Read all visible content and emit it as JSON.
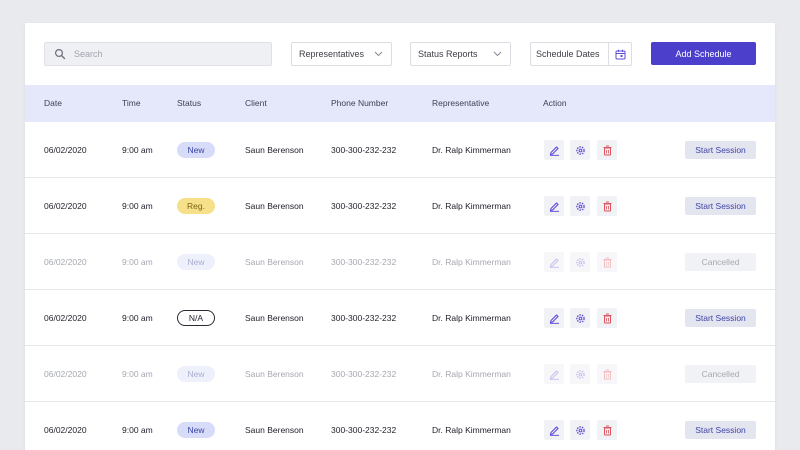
{
  "toolbar": {
    "search_placeholder": "Search",
    "representatives_label": "Representatives",
    "status_reports_label": "Status Reports",
    "schedule_dates_label": "Schedule Dates",
    "add_schedule_label": "Add Schedule"
  },
  "table": {
    "headers": {
      "date": "Date",
      "time": "Time",
      "status": "Status",
      "client": "Client",
      "phone": "Phone Number",
      "representative": "Representative",
      "action": "Action"
    },
    "rows": [
      {
        "date": "06/02/2020",
        "time": "9:00 am",
        "status": "New",
        "client": "Saun Berenson",
        "phone": "300-300-232-232",
        "representative": "Dr. Ralp Kimmerman",
        "session": "Start Session"
      },
      {
        "date": "06/02/2020",
        "time": "9:00 am",
        "status": "Reg.",
        "client": "Saun Berenson",
        "phone": "300-300-232-232",
        "representative": "Dr. Ralp Kimmerman",
        "session": "Start Session"
      },
      {
        "date": "06/02/2020",
        "time": "9:00 am",
        "status": "New",
        "client": "Saun Berenson",
        "phone": "300-300-232-232",
        "representative": "Dr. Ralp Kimmerman",
        "session": "Cancelled"
      },
      {
        "date": "06/02/2020",
        "time": "9:00 am",
        "status": "N/A",
        "client": "Saun Berenson",
        "phone": "300-300-232-232",
        "representative": "Dr. Ralp Kimmerman",
        "session": "Start Session"
      },
      {
        "date": "06/02/2020",
        "time": "9:00 am",
        "status": "New",
        "client": "Saun Berenson",
        "phone": "300-300-232-232",
        "representative": "Dr. Ralp Kimmerman",
        "session": "Cancelled"
      },
      {
        "date": "06/02/2020",
        "time": "9:00 am",
        "status": "New",
        "client": "Saun Berenson",
        "phone": "300-300-232-232",
        "representative": "Dr. Ralp Kimmerman",
        "session": "Start Session"
      }
    ]
  },
  "icons": {
    "search": "search-icon",
    "dropdown": "chevron-down-icon",
    "calendar": "calendar-icon",
    "edit": "edit-icon",
    "settings": "gear-icon",
    "delete": "trash-icon"
  },
  "colors": {
    "accent": "#4b3fcc",
    "header_bg": "#e5e8fb",
    "edit_icon": "#5b3fd6",
    "delete_icon": "#e0535f",
    "badge_new": "#d7dcf8",
    "badge_reg": "#f6e08a"
  }
}
